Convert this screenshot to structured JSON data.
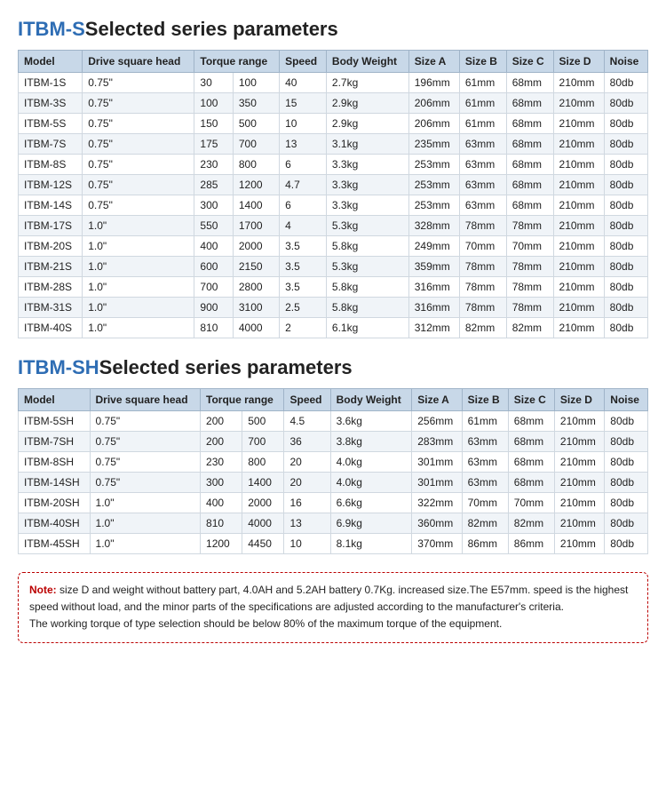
{
  "section1": {
    "title_highlight": "ITBM-S",
    "title_rest": "Selected series parameters",
    "columns": [
      "Model",
      "Drive square head",
      "Torque range",
      "",
      "Speed",
      "Body Weight",
      "Size A",
      "Size B",
      "Size C",
      "Size D",
      "Noise"
    ],
    "col_headers": [
      "Model",
      "Drive square head",
      "Torque range",
      "Speed",
      "Body Weight",
      "Size A",
      "Size B",
      "Size C",
      "Size D",
      "Noise"
    ],
    "rows": [
      [
        "ITBM-1S",
        "0.75\"",
        "30",
        "100",
        "40",
        "2.7kg",
        "196mm",
        "61mm",
        "68mm",
        "210mm",
        "80db"
      ],
      [
        "ITBM-3S",
        "0.75\"",
        "100",
        "350",
        "15",
        "2.9kg",
        "206mm",
        "61mm",
        "68mm",
        "210mm",
        "80db"
      ],
      [
        "ITBM-5S",
        "0.75\"",
        "150",
        "500",
        "10",
        "2.9kg",
        "206mm",
        "61mm",
        "68mm",
        "210mm",
        "80db"
      ],
      [
        "ITBM-7S",
        "0.75\"",
        "175",
        "700",
        "13",
        "3.1kg",
        "235mm",
        "63mm",
        "68mm",
        "210mm",
        "80db"
      ],
      [
        "ITBM-8S",
        "0.75\"",
        "230",
        "800",
        "6",
        "3.3kg",
        "253mm",
        "63mm",
        "68mm",
        "210mm",
        "80db"
      ],
      [
        "ITBM-12S",
        "0.75\"",
        "285",
        "1200",
        "4.7",
        "3.3kg",
        "253mm",
        "63mm",
        "68mm",
        "210mm",
        "80db"
      ],
      [
        "ITBM-14S",
        "0.75\"",
        "300",
        "1400",
        "6",
        "3.3kg",
        "253mm",
        "63mm",
        "68mm",
        "210mm",
        "80db"
      ],
      [
        "ITBM-17S",
        "1.0\"",
        "550",
        "1700",
        "4",
        "5.3kg",
        "328mm",
        "78mm",
        "78mm",
        "210mm",
        "80db"
      ],
      [
        "ITBM-20S",
        "1.0\"",
        "400",
        "2000",
        "3.5",
        "5.8kg",
        "249mm",
        "70mm",
        "70mm",
        "210mm",
        "80db"
      ],
      [
        "ITBM-21S",
        "1.0\"",
        "600",
        "2150",
        "3.5",
        "5.3kg",
        "359mm",
        "78mm",
        "78mm",
        "210mm",
        "80db"
      ],
      [
        "ITBM-28S",
        "1.0\"",
        "700",
        "2800",
        "3.5",
        "5.8kg",
        "316mm",
        "78mm",
        "78mm",
        "210mm",
        "80db"
      ],
      [
        "ITBM-31S",
        "1.0\"",
        "900",
        "3100",
        "2.5",
        "5.8kg",
        "316mm",
        "78mm",
        "78mm",
        "210mm",
        "80db"
      ],
      [
        "ITBM-40S",
        "1.0\"",
        "810",
        "4000",
        "2",
        "6.1kg",
        "312mm",
        "82mm",
        "82mm",
        "210mm",
        "80db"
      ]
    ]
  },
  "section2": {
    "title_highlight": "ITBM-SH",
    "title_rest": "Selected series parameters",
    "col_headers": [
      "Model",
      "Drive square head",
      "Torque range",
      "Speed",
      "Body Weight",
      "Size A",
      "Size B",
      "Size C",
      "Size D",
      "Noise"
    ],
    "rows": [
      [
        "ITBM-5SH",
        "0.75\"",
        "200",
        "500",
        "4.5",
        "3.6kg",
        "256mm",
        "61mm",
        "68mm",
        "210mm",
        "80db"
      ],
      [
        "ITBM-7SH",
        "0.75\"",
        "200",
        "700",
        "36",
        "3.8kg",
        "283mm",
        "63mm",
        "68mm",
        "210mm",
        "80db"
      ],
      [
        "ITBM-8SH",
        "0.75\"",
        "230",
        "800",
        "20",
        "4.0kg",
        "301mm",
        "63mm",
        "68mm",
        "210mm",
        "80db"
      ],
      [
        "ITBM-14SH",
        "0.75\"",
        "300",
        "1400",
        "20",
        "4.0kg",
        "301mm",
        "63mm",
        "68mm",
        "210mm",
        "80db"
      ],
      [
        "ITBM-20SH",
        "1.0\"",
        "400",
        "2000",
        "16",
        "6.6kg",
        "322mm",
        "70mm",
        "70mm",
        "210mm",
        "80db"
      ],
      [
        "ITBM-40SH",
        "1.0\"",
        "810",
        "4000",
        "13",
        "6.9kg",
        "360mm",
        "82mm",
        "82mm",
        "210mm",
        "80db"
      ],
      [
        "ITBM-45SH",
        "1.0\"",
        "1200",
        "4450",
        "10",
        "8.1kg",
        "370mm",
        "86mm",
        "86mm",
        "210mm",
        "80db"
      ]
    ]
  },
  "note": {
    "label": "Note:",
    "text": " size D and weight without battery part, 4.0AH and 5.2AH battery 0.7Kg. increased size.The E57mm. speed is the highest speed without load, and the minor parts of the specifications are adjusted according to the manufacturer's criteria.\nThe working torque of type selection should be below 80% of the maximum torque of the equipment."
  }
}
